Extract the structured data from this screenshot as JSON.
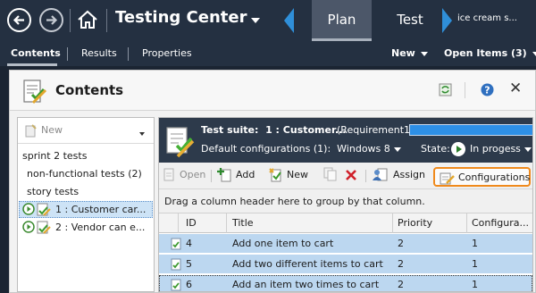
{
  "topbar": {
    "title": "Testing Center",
    "tabs": [
      {
        "label": "Plan",
        "active": true
      },
      {
        "label": "Test",
        "active": false
      },
      {
        "label": "ice cream s...",
        "active": false
      }
    ]
  },
  "subbar": {
    "nav": [
      {
        "label": "Contents",
        "active": true
      },
      {
        "label": "Results",
        "active": false
      },
      {
        "label": "Properties",
        "active": false
      }
    ],
    "new_label": "New",
    "open_items_label": "Open Items (3)"
  },
  "panel": {
    "title": "Contents"
  },
  "tree": {
    "new_label": "New",
    "items": [
      {
        "label": "sprint 2 tests"
      },
      {
        "label": "non-functional tests (2)"
      },
      {
        "label": "story tests"
      },
      {
        "label": "1 : Customer car..."
      },
      {
        "label": "2 : Vendor can e..."
      }
    ]
  },
  "suite": {
    "label": "Test suite:",
    "name": "1 : Customer...",
    "requirement": "(Requirement1)",
    "config_label": "Default configurations (1):",
    "config_value": "Windows 8",
    "state_label": "State:",
    "state_value": "In progess"
  },
  "toolbar": {
    "open": "Open",
    "add": "Add",
    "new": "New",
    "assign": "Assign",
    "configurations": "Configurations"
  },
  "groupbar": {
    "text": "Drag a column header here to group by that column."
  },
  "table": {
    "columns": [
      "ID",
      "Title",
      "Priority",
      "Configura..."
    ],
    "rows": [
      {
        "id": "4",
        "title": "Add one item to cart",
        "priority": "2",
        "config": "1"
      },
      {
        "id": "5",
        "title": "Add two different items to cart",
        "priority": "2",
        "config": "1"
      },
      {
        "id": "6",
        "title": "Add an item two times to cart",
        "priority": "2",
        "config": "1"
      }
    ]
  },
  "colors": {
    "topbar_bg": "#243041",
    "accent_blue": "#2f8fd9",
    "selection_blue": "#bcd7f0",
    "highlight_orange": "#f08a1c"
  }
}
